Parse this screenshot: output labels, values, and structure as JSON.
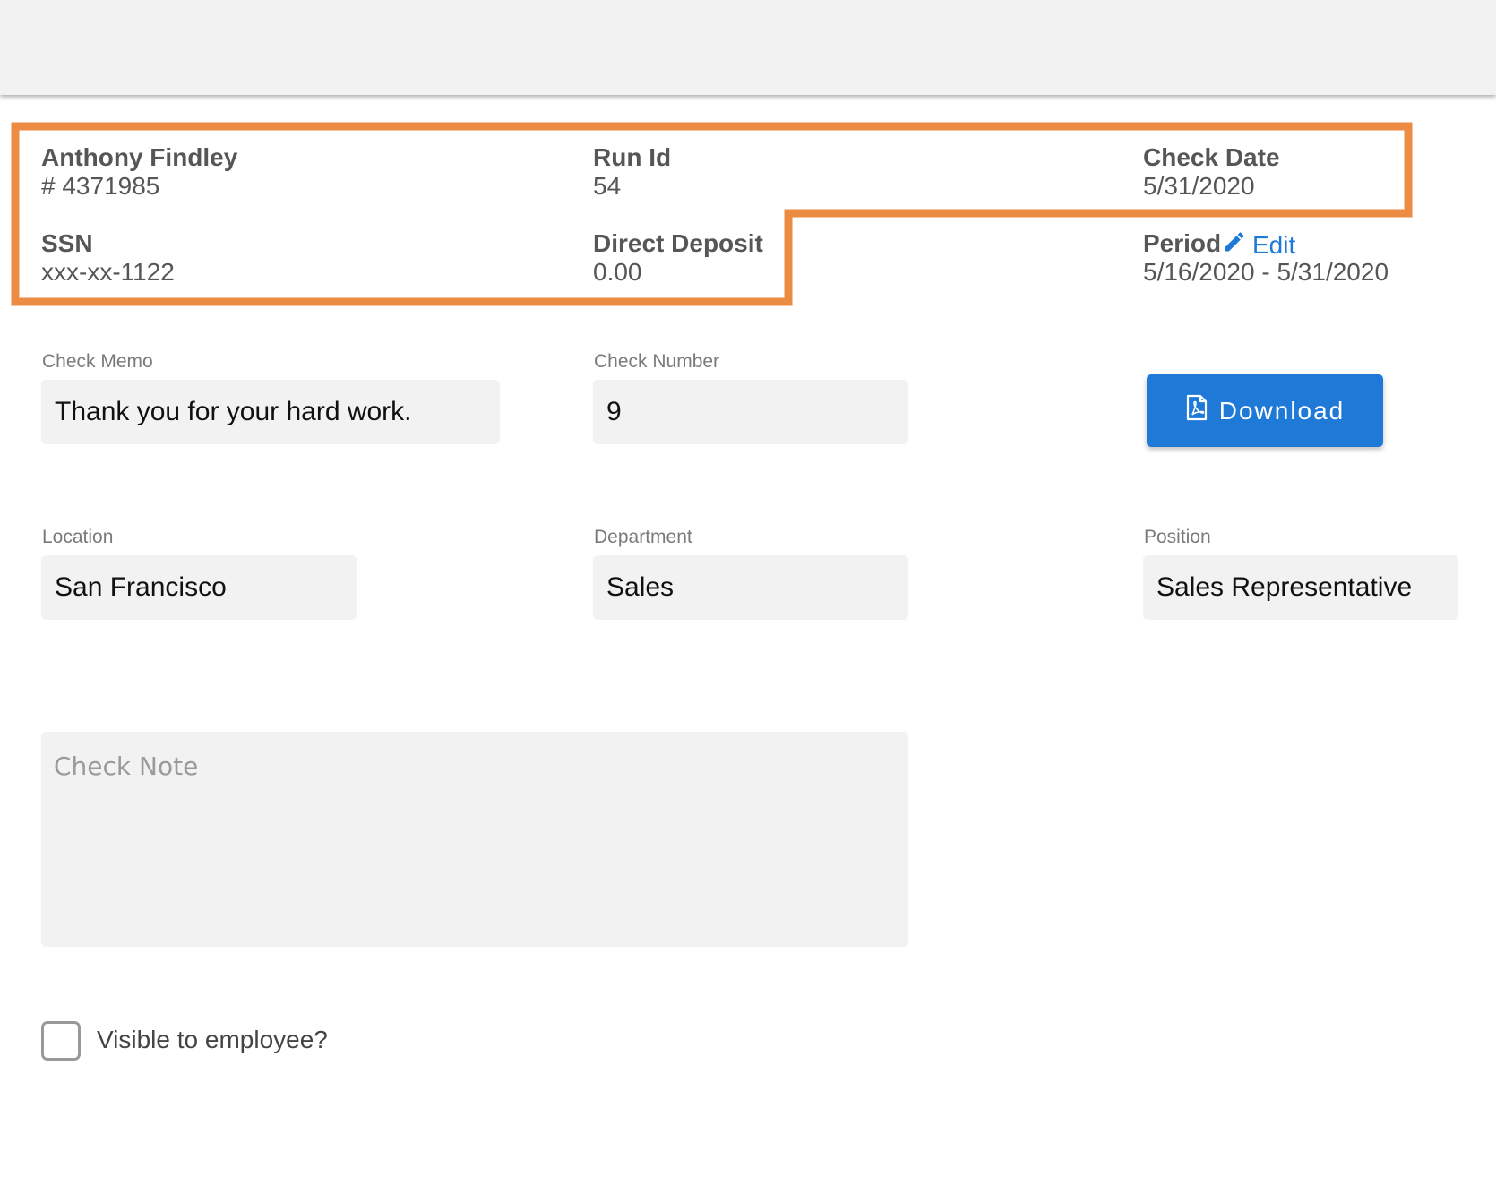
{
  "employee": {
    "name": "Anthony Findley",
    "number": "# 4371985",
    "ssn_label": "SSN",
    "ssn_value": "xxx-xx-1122"
  },
  "run": {
    "label": "Run Id",
    "value": "54"
  },
  "direct_deposit": {
    "label": "Direct Deposit",
    "value": "0.00"
  },
  "check_date": {
    "label": "Check Date",
    "value": "5/31/2020"
  },
  "period": {
    "label": "Period",
    "edit_label": "Edit",
    "value": "5/16/2020 - 5/31/2020"
  },
  "form": {
    "check_memo_label": "Check Memo",
    "check_memo_value": "Thank you for your hard work.",
    "check_number_label": "Check Number",
    "check_number_value": "9",
    "location_label": "Location",
    "location_value": "San Francisco",
    "department_label": "Department",
    "department_value": "Sales",
    "position_label": "Position",
    "position_value": "Sales Representative",
    "check_note_placeholder": "Check Note",
    "visible_label": "Visible to employee?",
    "visible_checked": false
  },
  "download": {
    "label": "Download",
    "icon": "file-pdf-icon"
  },
  "colors": {
    "highlight": "#ec8b42",
    "accent": "#1e7ad6",
    "field_bg": "#f2f2f2"
  }
}
